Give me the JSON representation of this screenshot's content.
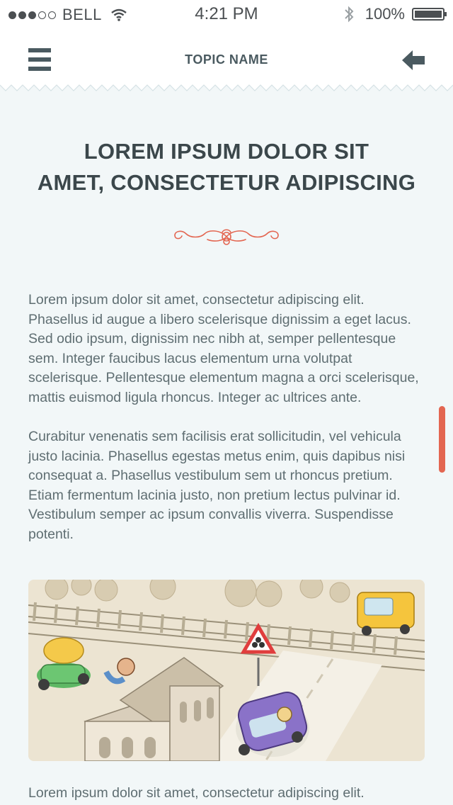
{
  "status": {
    "carrier": "BELL",
    "time": "4:21 PM",
    "battery": "100%",
    "signal_bars_filled": 3,
    "signal_bars_total": 5
  },
  "header": {
    "topic": "TOPIC NAME",
    "menu_icon": "hamburger-menu-icon",
    "back_icon": "arrow-left-icon"
  },
  "article": {
    "title_line1": "LOREM IPSUM DOLOR SIT",
    "title_line2": "AMET, CONSECTETUR ADIPISCING",
    "paragraphs": [
      "Lorem ipsum dolor sit amet, consectetur adipiscing elit. Phasellus id augue a libero scelerisque dignissim a eget lacus. Sed odio ipsum, dignissim nec nibh at, semper pellentesque sem. Integer faucibus lacus elementum urna volutpat scelerisque. Pellentesque elementum magna a orci scelerisque, mattis euismod ligula rhoncus. Integer ac ultrices ante.",
      "Curabitur venenatis sem facilisis erat sollicitudin, vel vehicula justo lacinia. Phasellus egestas metus enim, quis dapibus nisi consequat a. Phasellus vestibulum sem ut rhoncus pretium. Etiam fermentum lacinia justo, non pretium lectus pulvinar id. Vestibulum semper ac ipsum convallis viverra. Suspendisse potenti.",
      "Lorem ipsum dolor sit amet, consectetur adipiscing elit."
    ]
  },
  "colors": {
    "accent": "#e36651",
    "text_dark": "#3b474b",
    "background": "#f2f7f8"
  }
}
